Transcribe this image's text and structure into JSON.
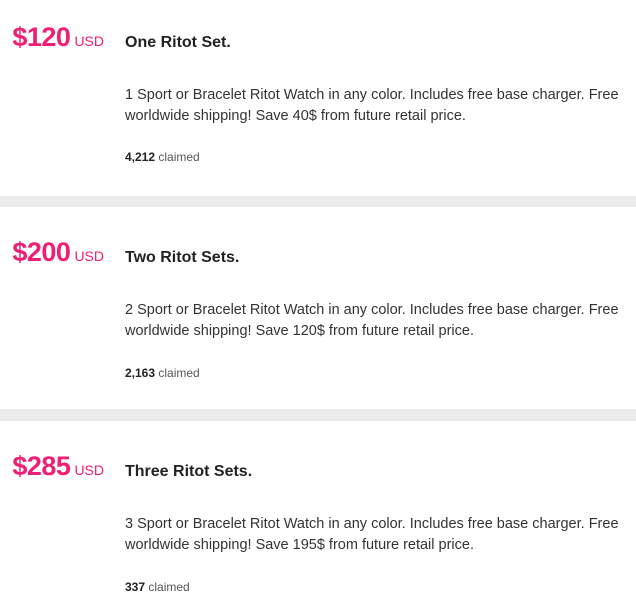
{
  "colors": {
    "price": "#ee1f74",
    "divider": "#ebebeb"
  },
  "perks": [
    {
      "amount": "$120",
      "currency": "USD",
      "title": "One Ritot Set.",
      "description": "1 Sport or Bracelet Ritot Watch in any color. Includes free base charger. Free worldwide shipping! Save 40$ from future retail price.",
      "claimed_count": "4,212",
      "claimed_label": "claimed"
    },
    {
      "amount": "$200",
      "currency": "USD",
      "title": "Two Ritot Sets.",
      "description": "2 Sport or Bracelet Ritot Watch in any color. Includes free base charger. Free worldwide shipping! Save 120$ from future retail price.",
      "claimed_count": "2,163",
      "claimed_label": "claimed"
    },
    {
      "amount": "$285",
      "currency": "USD",
      "title": "Three Ritot Sets.",
      "description": "3 Sport or Bracelet Ritot Watch in any color. Includes free base charger. Free worldwide shipping! Save 195$ from future retail price.",
      "claimed_count": "337",
      "claimed_label": "claimed"
    }
  ]
}
